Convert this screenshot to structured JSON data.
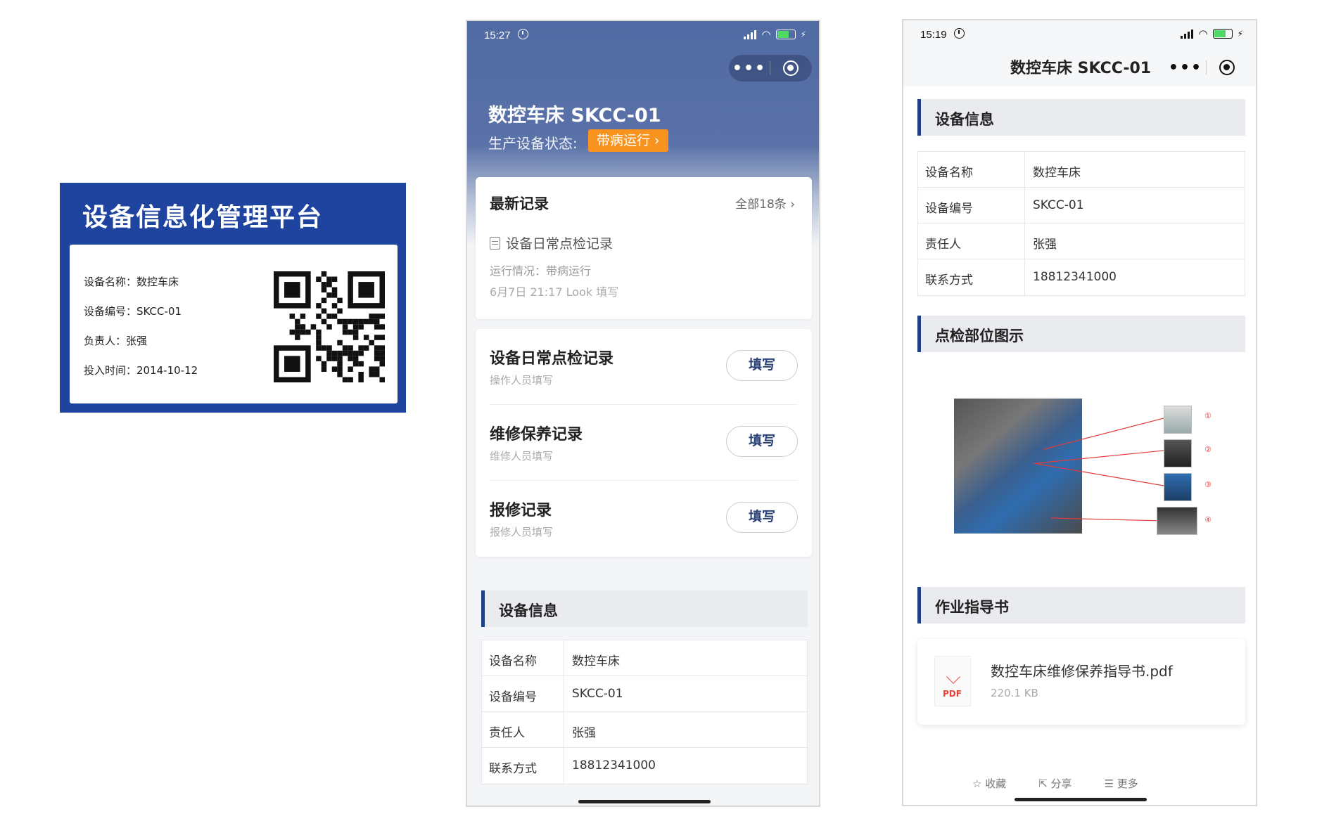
{
  "label_card": {
    "title": "设备信息化管理平台",
    "rows": [
      "设备名称：数控车床",
      "设备编号：SKCC-01",
      "负责人：张强",
      "投入时间：2014-10-12"
    ]
  },
  "phone1": {
    "status_time": "15:27",
    "equipment_name": "数控车床 SKCC-01",
    "status_label": "生产设备状态:",
    "status_badge": "带病运行 ›",
    "latest": {
      "title": "最新记录",
      "all_link": "全部18条 ›",
      "record_title": "设备日常点检记录",
      "record_status": "运行情况：带病运行",
      "record_meta": "6月7日 21:17 Look 填写"
    },
    "forms": [
      {
        "title": "设备日常点检记录",
        "subtitle": "操作人员填写",
        "button": "填写"
      },
      {
        "title": "维修保养记录",
        "subtitle": "维修人员填写",
        "button": "填写"
      },
      {
        "title": "报修记录",
        "subtitle": "报修人员填写",
        "button": "填写"
      }
    ],
    "info_title": "设备信息",
    "info_rows": [
      {
        "k": "设备名称",
        "v": "数控车床"
      },
      {
        "k": "设备编号",
        "v": "SKCC-01"
      },
      {
        "k": "责任人",
        "v": "张强"
      },
      {
        "k": "联系方式",
        "v": "18812341000"
      }
    ]
  },
  "phone2": {
    "status_time": "15:19",
    "nav_title": "数控车床 SKCC-01",
    "info_title": "设备信息",
    "info_rows": [
      {
        "k": "设备名称",
        "v": "数控车床"
      },
      {
        "k": "设备编号",
        "v": "SKCC-01"
      },
      {
        "k": "责任人",
        "v": "张强"
      },
      {
        "k": "联系方式",
        "v": "18812341000"
      }
    ],
    "diagram_title": "点检部位图示",
    "diagram_markers": [
      "①",
      "②",
      "③",
      "④"
    ],
    "manual_title": "作业指导书",
    "pdf": {
      "name": "数控车床维修保养指导书.pdf",
      "size": "220.1 KB",
      "icon_text": "PDF"
    },
    "bottom_actions": [
      "☆ 收藏",
      "⇱ 分享",
      "☰ 更多"
    ]
  },
  "colors": {
    "brand_blue": "#1f44a0",
    "hero_blue": "#506aa3",
    "badge_orange": "#f7931e",
    "section_accent": "#1f3f86"
  }
}
